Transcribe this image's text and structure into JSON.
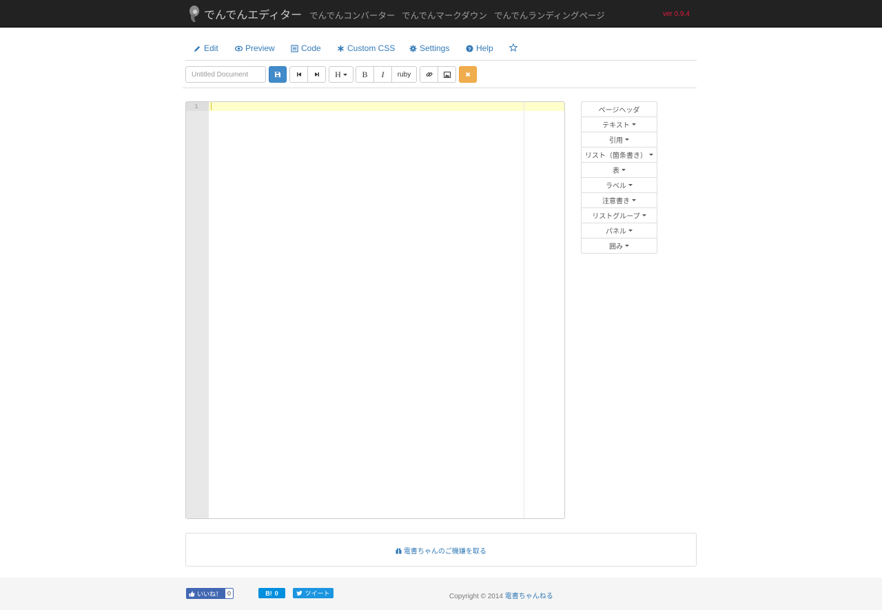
{
  "navbar": {
    "brand": "でんでんエディター",
    "links": [
      "でんでんコンバーター",
      "でんでんマークダウン",
      "でんでんランディングページ"
    ],
    "version": "ver 0.9.4",
    "version_color": "#e31b3c"
  },
  "tabs": {
    "edit": "Edit",
    "preview": "Preview",
    "code": "Code",
    "custom_css": "Custom CSS",
    "settings": "Settings",
    "help": "Help"
  },
  "toolbar": {
    "title_placeholder": "Untitled Document",
    "heading": "H",
    "bold": "B",
    "italic": "I",
    "ruby": "ruby"
  },
  "editor": {
    "line_number": "1"
  },
  "side_menu": {
    "items": [
      "ページヘッダ",
      "テキスト",
      "引用",
      "リスト（箇条書き）",
      "表",
      "ラベル",
      "注意書き",
      "リストグループ",
      "パネル",
      "囲み"
    ]
  },
  "panel": {
    "link": "電書ちゃんのご機嫌を取る"
  },
  "footer": {
    "like_label": "いいね！",
    "like_count": "0",
    "hatena_label": "B!",
    "hatena_count": "0",
    "tweet_label": "ツイート",
    "copyright": "Copyright © 2014",
    "copyright_link": "電書ちゃんねる"
  },
  "colors": {
    "navbar": "#222222",
    "link": "#337ab7",
    "primary": "#428bca",
    "warning": "#f0ad4e",
    "active_line": "#ffffcc"
  }
}
